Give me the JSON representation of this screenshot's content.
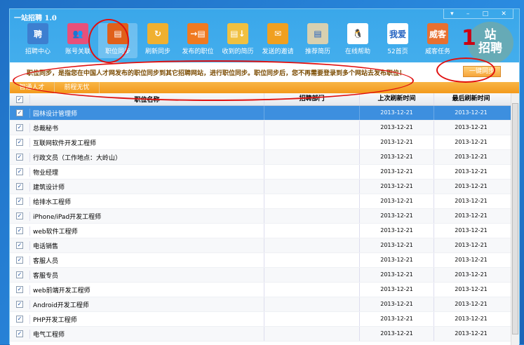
{
  "app": {
    "title": "一站招聘 1.0",
    "window_controls": [
      "▾",
      "–",
      "□",
      "✕"
    ],
    "logo_text": [
      "站",
      "招聘"
    ],
    "logo_digit": "1"
  },
  "toolbar": [
    {
      "label": "招聘中心",
      "glyph": "聘",
      "color": "#3d7fd0"
    },
    {
      "label": "账号关联",
      "glyph": "👥",
      "color": "#e8507a"
    },
    {
      "label": "职位同步",
      "glyph": "▤",
      "color": "#e0601a",
      "selected": true
    },
    {
      "label": "刷新同步",
      "glyph": "↻",
      "color": "#f0b030"
    },
    {
      "label": "发布的职位",
      "glyph": "→▤",
      "color": "#f07a20"
    },
    {
      "label": "收到的简历",
      "glyph": "▤↓",
      "color": "#f0c040"
    },
    {
      "label": "发送的邀请",
      "glyph": "✉",
      "color": "#f0a020"
    },
    {
      "label": "推荐简历",
      "glyph": "▤",
      "color": "#d8d0b0"
    },
    {
      "label": "在线帮助",
      "glyph": "🐧",
      "color": "#ffffff"
    },
    {
      "label": "52首页",
      "glyph": "我爱",
      "color": "#ffffff"
    },
    {
      "label": "威客任务",
      "glyph": "威客",
      "color": "#e87030"
    }
  ],
  "info": {
    "text": "职位同步，是指您在中国人才网发布的职位同步到其它招聘网站，进行职位同步。职位同步后，您不再需要登录到多个网站去发布职位！",
    "sync_button": "一键同步"
  },
  "tabs": [
    "智通人才",
    "前程无忧"
  ],
  "table": {
    "headers": [
      "职位名称",
      "招聘部门",
      "上次刷新时间",
      "最后刷新时间"
    ],
    "rows": [
      {
        "name": "园林设计管理师",
        "dept": "",
        "last": "2013-12-21",
        "final": "2013-12-21"
      },
      {
        "name": "总裁秘书",
        "dept": "",
        "last": "2013-12-21",
        "final": "2013-12-21"
      },
      {
        "name": "互联网软件开发工程师",
        "dept": "",
        "last": "2013-12-21",
        "final": "2013-12-21"
      },
      {
        "name": "行政文员（工作地点：大岭山）",
        "dept": "",
        "last": "2013-12-21",
        "final": "2013-12-21"
      },
      {
        "name": "物业经理",
        "dept": "",
        "last": "2013-12-21",
        "final": "2013-12-21"
      },
      {
        "name": "建筑设计师",
        "dept": "",
        "last": "2013-12-21",
        "final": "2013-12-21"
      },
      {
        "name": "给排水工程师",
        "dept": "",
        "last": "2013-12-21",
        "final": "2013-12-21"
      },
      {
        "name": "iPhone/iPad开发工程师",
        "dept": "",
        "last": "2013-12-21",
        "final": "2013-12-21"
      },
      {
        "name": "web软件工程师",
        "dept": "",
        "last": "2013-12-21",
        "final": "2013-12-21"
      },
      {
        "name": "电话销售",
        "dept": "",
        "last": "2013-12-21",
        "final": "2013-12-21"
      },
      {
        "name": "客服人员",
        "dept": "",
        "last": "2013-12-21",
        "final": "2013-12-21"
      },
      {
        "name": "客服专员",
        "dept": "",
        "last": "2013-12-21",
        "final": "2013-12-21"
      },
      {
        "name": "web前端开发工程师",
        "dept": "",
        "last": "2013-12-21",
        "final": "2013-12-21"
      },
      {
        "name": "Android开发工程师",
        "dept": "",
        "last": "2013-12-21",
        "final": "2013-12-21"
      },
      {
        "name": "PHP开发工程师",
        "dept": "",
        "last": "2013-12-21",
        "final": "2013-12-21"
      },
      {
        "name": "电气工程师",
        "dept": "",
        "last": "2013-12-21",
        "final": "2013-12-21"
      }
    ]
  }
}
